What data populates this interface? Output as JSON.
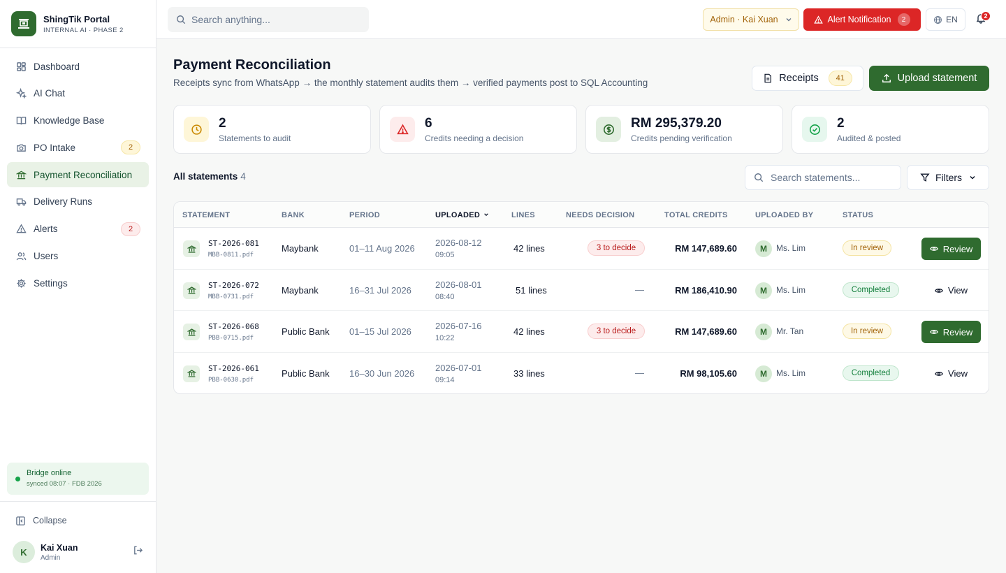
{
  "app": {
    "name": "ShingTik Portal",
    "subtitle": "INTERNAL AI · PHASE 2"
  },
  "nav": [
    {
      "label": "Dashboard",
      "icon": "dashboard-icon",
      "badge": ""
    },
    {
      "label": "AI Chat",
      "icon": "sparkle-icon",
      "badge": ""
    },
    {
      "label": "Knowledge Base",
      "icon": "book-icon",
      "badge": ""
    },
    {
      "label": "PO Intake",
      "icon": "camera-icon",
      "badge": "2",
      "badge_color": "yellow"
    },
    {
      "label": "Payment Reconciliation",
      "icon": "bank-icon",
      "badge": "",
      "active": true
    },
    {
      "label": "Delivery Runs",
      "icon": "truck-icon",
      "badge": ""
    },
    {
      "label": "Alerts",
      "icon": "alert-triangle-icon",
      "badge": "2",
      "badge_color": "red"
    },
    {
      "label": "Users",
      "icon": "users-icon",
      "badge": ""
    },
    {
      "label": "Settings",
      "icon": "gear-icon",
      "badge": ""
    }
  ],
  "bridge": {
    "title": "Bridge online",
    "sub": "synced 08:07 · FDB 2026"
  },
  "sidebar_footer": {
    "collapse_label": "Collapse",
    "user_initial": "K",
    "user_name": "Kai Xuan",
    "user_role": "Admin"
  },
  "topbar": {
    "search_placeholder": "Search anything...",
    "admin_label": "Admin · Kai Xuan",
    "alert_label": "Alert Notification",
    "alert_count": "2",
    "lang": "EN",
    "bell_count": "2"
  },
  "page": {
    "title": "Payment Reconciliation",
    "subtitle": "Receipts sync from WhatsApp → the monthly statement audits them → verified payments post to SQL Accounting",
    "receipts_label": "Receipts",
    "receipts_count": "41",
    "upload_label": "Upload statement"
  },
  "kpis": [
    {
      "value": "2",
      "label": "Statements to audit",
      "icon": "clock-icon",
      "bg": "#fef6d8",
      "fg": "#ca8a04"
    },
    {
      "value": "6",
      "label": "Credits needing a decision",
      "icon": "alert-triangle-icon",
      "bg": "#fdecec",
      "fg": "#dc2626"
    },
    {
      "value": "RM 295,379.20",
      "label": "Credits pending verification",
      "icon": "dollar-icon",
      "bg": "#e3efe1",
      "fg": "#2f6b2f"
    },
    {
      "value": "2",
      "label": "Audited & posted",
      "icon": "check-circle-icon",
      "bg": "#e6f7ee",
      "fg": "#16a34a"
    }
  ],
  "section": {
    "title": "All statements",
    "count": "4",
    "search_placeholder": "Search statements...",
    "filters_label": "Filters"
  },
  "table": {
    "headers": [
      "STATEMENT",
      "BANK",
      "PERIOD",
      "UPLOADED",
      "LINES",
      "NEEDS DECISION",
      "TOTAL CREDITS",
      "UPLOADED BY",
      "STATUS"
    ],
    "rows": [
      {
        "id": "ST-2026-081",
        "file": "MBB-0811.pdf",
        "bank": "Maybank",
        "period": "01–11 Aug 2026",
        "date": "2026-08-12",
        "time": "09:05",
        "lines": "42 lines",
        "decision": "3 to decide",
        "credits": "RM 147,689.60",
        "initial": "M",
        "by": "Ms. Lim",
        "status": "In review",
        "action": "Review"
      },
      {
        "id": "ST-2026-072",
        "file": "MBB-0731.pdf",
        "bank": "Maybank",
        "period": "16–31 Jul 2026",
        "date": "2026-08-01",
        "time": "08:40",
        "lines": "51 lines",
        "decision": "—",
        "credits": "RM 186,410.90",
        "initial": "M",
        "by": "Ms. Lim",
        "status": "Completed",
        "action": "View"
      },
      {
        "id": "ST-2026-068",
        "file": "PBB-0715.pdf",
        "bank": "Public Bank",
        "period": "01–15 Jul 2026",
        "date": "2026-07-16",
        "time": "10:22",
        "lines": "42 lines",
        "decision": "3 to decide",
        "credits": "RM 147,689.60",
        "initial": "M",
        "by": "Mr. Tan",
        "status": "In review",
        "action": "Review"
      },
      {
        "id": "ST-2026-061",
        "file": "PBB-0630.pdf",
        "bank": "Public Bank",
        "period": "16–30 Jun 2026",
        "date": "2026-07-01",
        "time": "09:14",
        "lines": "33 lines",
        "decision": "—",
        "credits": "RM 98,105.60",
        "initial": "M",
        "by": "Ms. Lim",
        "status": "Completed",
        "action": "View"
      }
    ]
  }
}
